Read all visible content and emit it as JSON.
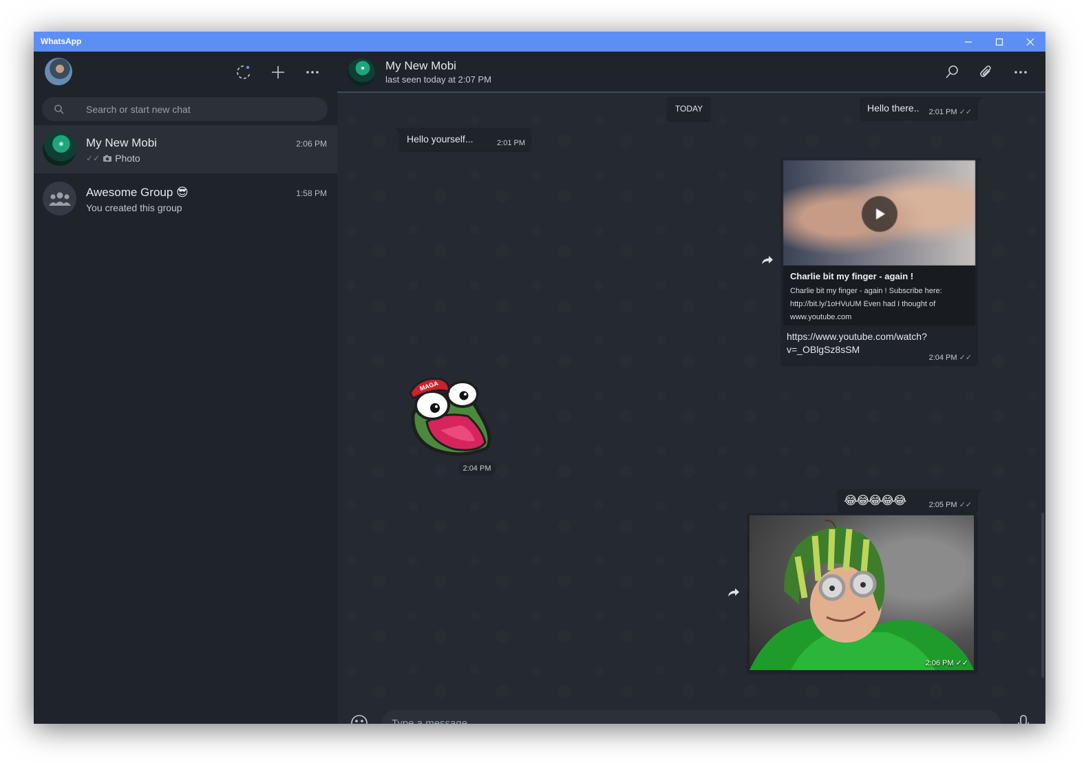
{
  "window": {
    "title": "WhatsApp"
  },
  "sidebar": {
    "search_placeholder": "Search or start new chat",
    "chats": [
      {
        "name": "My New Mobi",
        "time": "2:06 PM",
        "preview_icon": "camera-icon",
        "preview": "Photo",
        "ticks": "✓✓",
        "active": true
      },
      {
        "name": "Awesome Group 😎",
        "time": "1:58 PM",
        "preview": "You created this group",
        "active": false
      }
    ]
  },
  "conversation": {
    "contact_name": "My New Mobi",
    "status": "last seen today at 2:07 PM",
    "date_divider": "TODAY",
    "messages": [
      {
        "type": "text",
        "direction": "out",
        "text": "Hello there..",
        "time": "2:01 PM",
        "ticks": "✓✓"
      },
      {
        "type": "text",
        "direction": "in",
        "text": "Hello yourself...",
        "time": "2:01 PM"
      },
      {
        "type": "link",
        "direction": "out",
        "preview_title": "Charlie bit my finger - again !",
        "preview_desc": "Charlie bit my finger - again ! Subscribe here: http://bit.ly/1oHVuUM Even had I thought of",
        "preview_domain": "www.youtube.com",
        "url_line1": "https://www.youtube.com/watch?",
        "url_line2": "v=_OBlgSz8sSM",
        "time": "2:04 PM",
        "ticks": "✓✓"
      },
      {
        "type": "sticker",
        "direction": "in",
        "sticker_label": "MAGA",
        "time": "2:04 PM"
      },
      {
        "type": "text",
        "direction": "out",
        "text": "😂😂😂😂😂",
        "time": "2:05 PM",
        "ticks": "✓✓"
      },
      {
        "type": "photo",
        "direction": "out",
        "time": "2:06 PM",
        "ticks": "✓✓"
      }
    ]
  },
  "composer": {
    "placeholder": "Type a message"
  },
  "colors": {
    "titlebar": "#5d8ef5",
    "panel": "#1f232a",
    "chat_bg": "#252a32",
    "bubble": "#1f232a",
    "text": "#e6e8eb"
  }
}
